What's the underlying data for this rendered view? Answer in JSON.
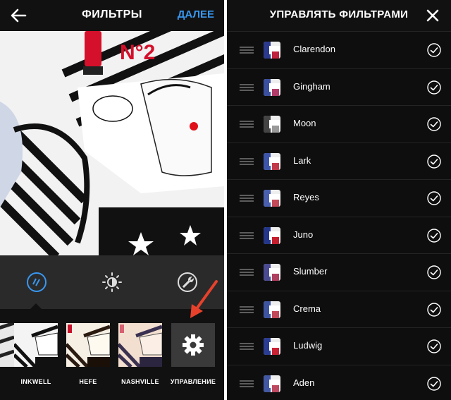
{
  "left_header": {
    "title": "ФИЛЬТРЫ",
    "next_label": "ДАЛЕЕ"
  },
  "filters": [
    {
      "label": "INKWELL"
    },
    {
      "label": "HEFE"
    },
    {
      "label": "NASHVILLE"
    },
    {
      "label": "УПРАВЛЕНИЕ"
    }
  ],
  "right_header": {
    "title": "УПРАВЛЯТЬ ФИЛЬТРАМИ"
  },
  "filter_list": [
    {
      "name": "Clarendon"
    },
    {
      "name": "Gingham"
    },
    {
      "name": "Moon"
    },
    {
      "name": "Lark"
    },
    {
      "name": "Reyes"
    },
    {
      "name": "Juno"
    },
    {
      "name": "Slumber"
    },
    {
      "name": "Crema"
    },
    {
      "name": "Ludwig"
    },
    {
      "name": "Aden"
    }
  ],
  "colors": {
    "accent": "#3897f0",
    "annotation_arrow": "#e8412b"
  }
}
